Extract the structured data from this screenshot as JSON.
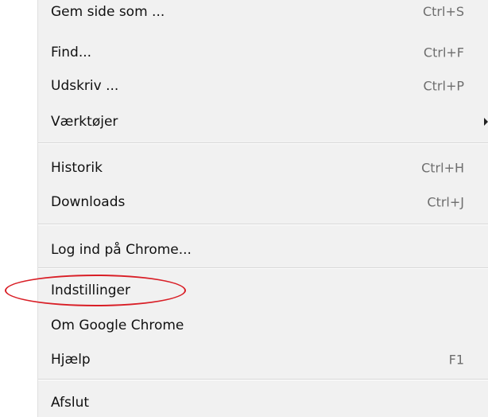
{
  "menu": {
    "groups": [
      {
        "items": [
          {
            "label": "Gem side som ...",
            "shortcut": "Ctrl+S"
          },
          {
            "label": "Find...",
            "shortcut": "Ctrl+F"
          },
          {
            "label": "Udskriv ...",
            "shortcut": "Ctrl+P"
          },
          {
            "label": "Værktøjer",
            "shortcut": "",
            "submenu": true
          }
        ]
      },
      {
        "items": [
          {
            "label": "Historik",
            "shortcut": "Ctrl+H"
          },
          {
            "label": "Downloads",
            "shortcut": "Ctrl+J"
          }
        ]
      },
      {
        "items": [
          {
            "label": "Log ind på Chrome...",
            "shortcut": ""
          }
        ]
      },
      {
        "items": [
          {
            "label": "Indstillinger",
            "shortcut": "",
            "highlighted": true
          },
          {
            "label": "Om Google Chrome",
            "shortcut": ""
          },
          {
            "label": "Hjælp",
            "shortcut": "F1"
          }
        ]
      },
      {
        "items": [
          {
            "label": "Afslut",
            "shortcut": ""
          }
        ]
      }
    ]
  },
  "annotation": {
    "color": "#d91f27",
    "target": "Indstillinger"
  }
}
